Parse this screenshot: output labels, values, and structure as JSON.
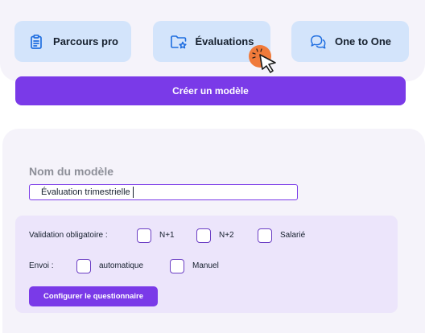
{
  "tiles": [
    {
      "label": "Parcours pro",
      "icon": "clipboard-icon"
    },
    {
      "label": "Évaluations",
      "icon": "folder-star-icon"
    },
    {
      "label": "One to One",
      "icon": "chat-bubbles-icon"
    }
  ],
  "create_button": {
    "label": "Créer un modèle"
  },
  "form": {
    "title": "Nom du modèle",
    "name_value": "Évaluation trimestrielle",
    "validation": {
      "label": "Validation obligatoire :",
      "options": [
        {
          "label": "N+1",
          "checked": false
        },
        {
          "label": "N+2",
          "checked": false
        },
        {
          "label": "Salarié",
          "checked": false
        }
      ]
    },
    "envoi": {
      "label": "Envoi :",
      "options": [
        {
          "label": "automatique",
          "checked": false
        },
        {
          "label": "Manuel",
          "checked": false
        }
      ]
    },
    "configure_button": {
      "label": "Configurer le questionnaire"
    }
  },
  "colors": {
    "accent": "#7a3ae8",
    "tile_bg": "#d3e4fb",
    "icon": "#1f6ee0",
    "panel_bg": "#f5f3fa",
    "card_bg": "#ece5fb",
    "cursor_dot": "#f07a3a"
  }
}
